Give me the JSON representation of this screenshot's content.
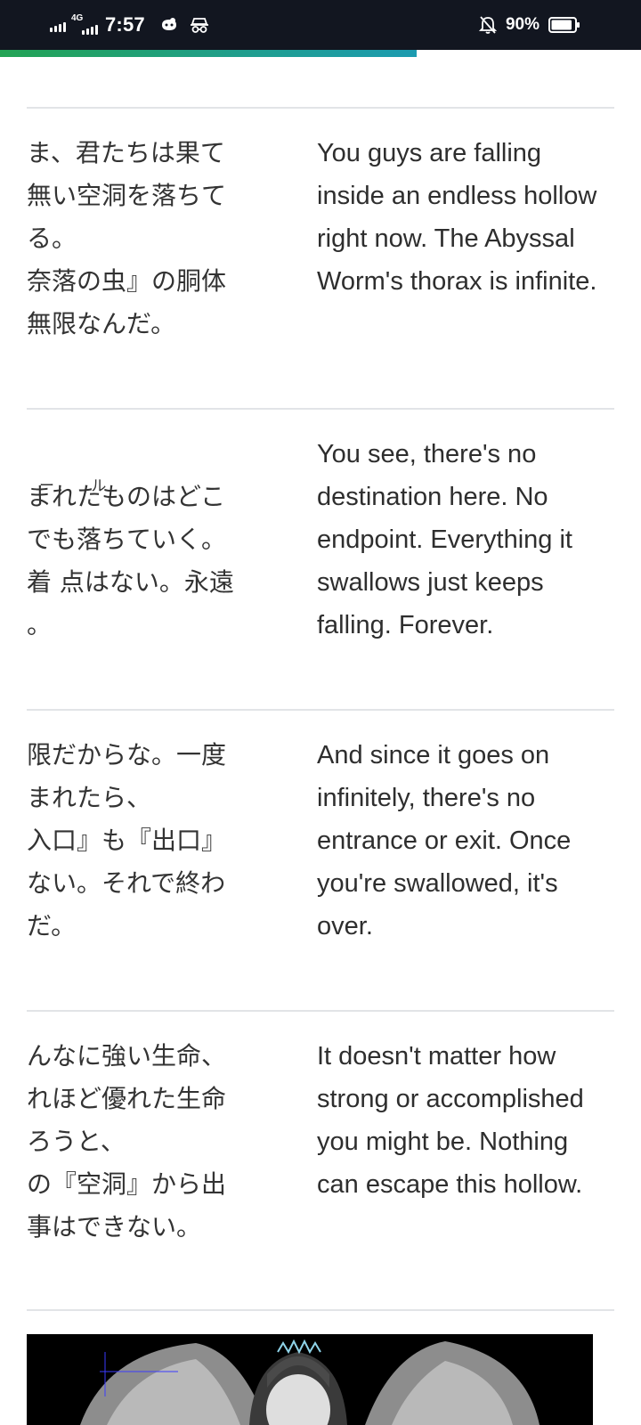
{
  "status_bar": {
    "time": "7:57",
    "network": "4G",
    "battery_percent": "90%",
    "battery_level": 0.9,
    "icons": [
      "signal-icon",
      "mobile-data-icon",
      "notification-app-icon",
      "incognito-icon",
      "alarm-muted-icon",
      "battery-icon"
    ]
  },
  "reading_progress": 0.65,
  "colors": {
    "status_bar_bg": "#121620",
    "progress_start": "#23a354",
    "progress_end": "#1c9bb0",
    "divider": "#e2e4e7"
  },
  "rows": [
    {
      "jp": "ま、君たちは果て\n無い空洞を落ちて\nる。\n奈落の虫』の胴体\n無限なんだ。",
      "en": "You guys are falling inside an endless hollow right now. The Abyssal Worm's thorax is infinite."
    },
    {
      "jp": "まれたものはどこ\nでも落ちていく。\n着 点はない。永遠\n。",
      "jp_ruby": "ー ル",
      "en": "You see, there's no destination here. No endpoint. Everything it swallows just keeps falling. Forever."
    },
    {
      "jp": "限だからな。一度\nまれたら、\n入口』も『出口』\nない。それで終わ\nだ。",
      "en": "And since it goes on infinitely, there's no entrance or exit. Once you're swallowed, it's over."
    },
    {
      "jp": "んなに強い生命、\nれほど優れた生命\nろうと、\nの『空洞』から出\n事はできない。",
      "en": "It doesn't matter how strong or accomplished you might be. Nothing can escape this hollow."
    }
  ],
  "illustration": {
    "alt": "winged-character-illustration"
  }
}
